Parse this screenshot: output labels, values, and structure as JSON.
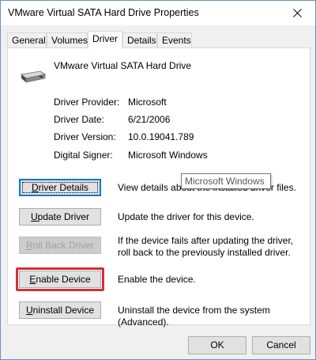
{
  "window": {
    "title": "VMware Virtual SATA Hard Drive Properties"
  },
  "tabs": [
    {
      "label": "General"
    },
    {
      "label": "Volumes"
    },
    {
      "label": "Driver"
    },
    {
      "label": "Details"
    },
    {
      "label": "Events"
    }
  ],
  "device": {
    "name": "VMware Virtual SATA Hard Drive",
    "icon": "hard-drive-icon"
  },
  "info": {
    "provider_label": "Driver Provider:",
    "provider_value": "Microsoft",
    "date_label": "Driver Date:",
    "date_value": "6/21/2006",
    "version_label": "Driver Version:",
    "version_value": "10.0.19041.789",
    "signer_label": "Digital Signer:",
    "signer_value": "Microsoft Windows"
  },
  "actions": {
    "details_accel": "D",
    "details_rest": "river Details",
    "details_desc": "View details about the installed driver files.",
    "update_accel": "U",
    "update_pre": "",
    "update_rest": "pdate Driver",
    "update_desc": "Update the driver for this device.",
    "rollback_accel": "R",
    "rollback_rest": "oll Back Driver",
    "rollback_desc": "If the device fails after updating the driver, roll back to the previously installed driver.",
    "enable_accel": "E",
    "enable_rest": "nable Device",
    "enable_desc": "Enable the device.",
    "uninstall_accel": "U",
    "uninstall_rest": "ninstall Device",
    "uninstall_desc": "Uninstall the device from the system (Advanced)."
  },
  "tooltip": {
    "text": "Microsoft Windows"
  },
  "footer": {
    "ok": "OK",
    "cancel": "Cancel"
  },
  "colors": {
    "highlight": "#d1303a",
    "focus": "#0078d7"
  }
}
